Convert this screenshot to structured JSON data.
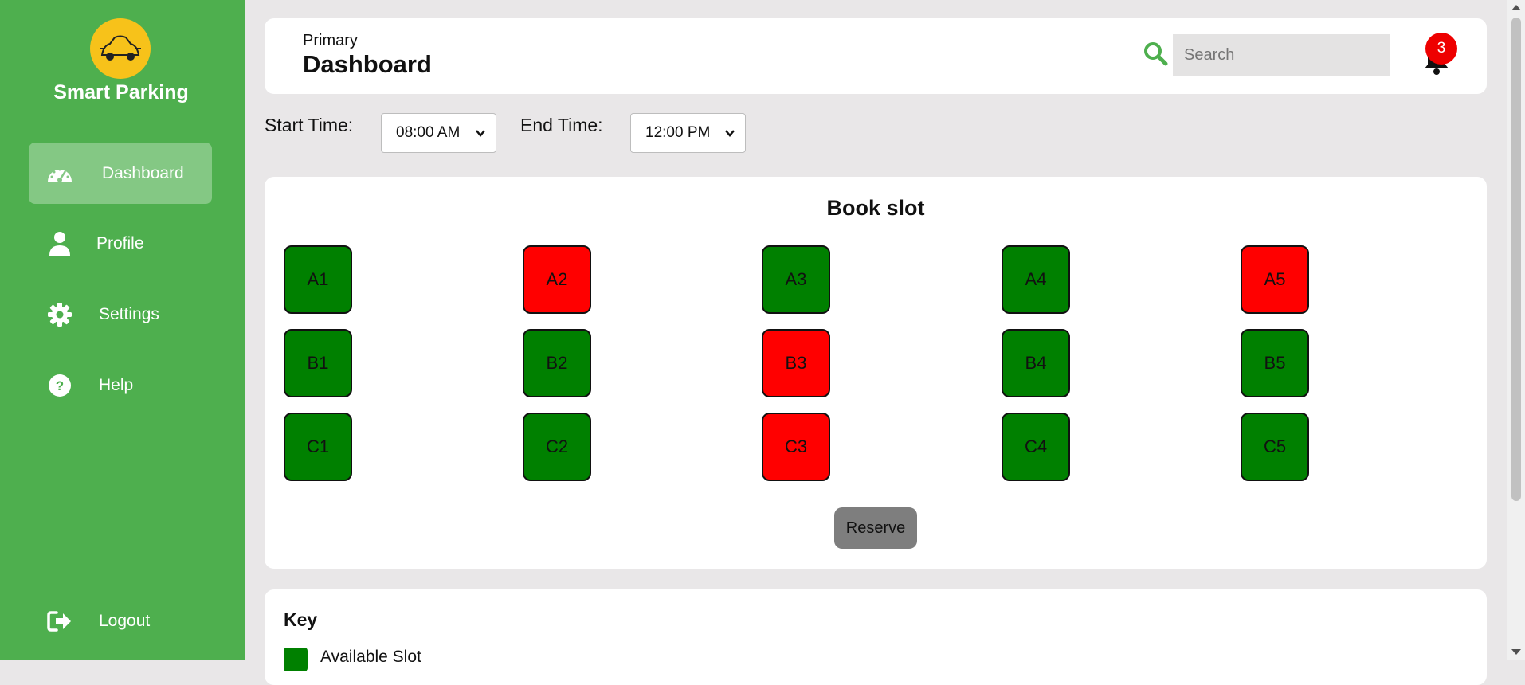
{
  "app": {
    "logo_text": "Smart Parking",
    "logo_badge_text": "Smart Parking"
  },
  "sidebar": {
    "items": [
      {
        "label": "Dashboard",
        "icon": "dashboard-icon",
        "active": true
      },
      {
        "label": "Profile",
        "icon": "user-icon",
        "active": false
      },
      {
        "label": "Settings",
        "icon": "gear-icon",
        "active": false
      },
      {
        "label": "Help",
        "icon": "help-icon",
        "active": false
      }
    ],
    "logout_label": "Logout"
  },
  "header": {
    "subtitle": "Primary",
    "title": "Dashboard",
    "search_placeholder": "Search",
    "notification_count": "3"
  },
  "time": {
    "start_label": "Start Time:",
    "start_value": "08:00 AM",
    "end_label": "End Time:",
    "end_value": "12:00 PM"
  },
  "booking": {
    "title": "Book slot",
    "reserve_label": "Reserve",
    "rows": [
      [
        {
          "id": "A1",
          "status": "available"
        },
        {
          "id": "A2",
          "status": "booked"
        },
        {
          "id": "A3",
          "status": "available"
        },
        {
          "id": "A4",
          "status": "available"
        },
        {
          "id": "A5",
          "status": "booked"
        }
      ],
      [
        {
          "id": "B1",
          "status": "available"
        },
        {
          "id": "B2",
          "status": "available"
        },
        {
          "id": "B3",
          "status": "booked"
        },
        {
          "id": "B4",
          "status": "available"
        },
        {
          "id": "B5",
          "status": "available"
        }
      ],
      [
        {
          "id": "C1",
          "status": "available"
        },
        {
          "id": "C2",
          "status": "available"
        },
        {
          "id": "C3",
          "status": "booked"
        },
        {
          "id": "C4",
          "status": "available"
        },
        {
          "id": "C5",
          "status": "available"
        }
      ]
    ]
  },
  "key": {
    "title": "Key",
    "items": [
      {
        "label": "Available Slot",
        "color": "#008000"
      }
    ]
  },
  "colors": {
    "sidebar_bg": "#4eaf4e",
    "available": "#008000",
    "booked": "#ff0000",
    "badge": "#ee0000"
  }
}
